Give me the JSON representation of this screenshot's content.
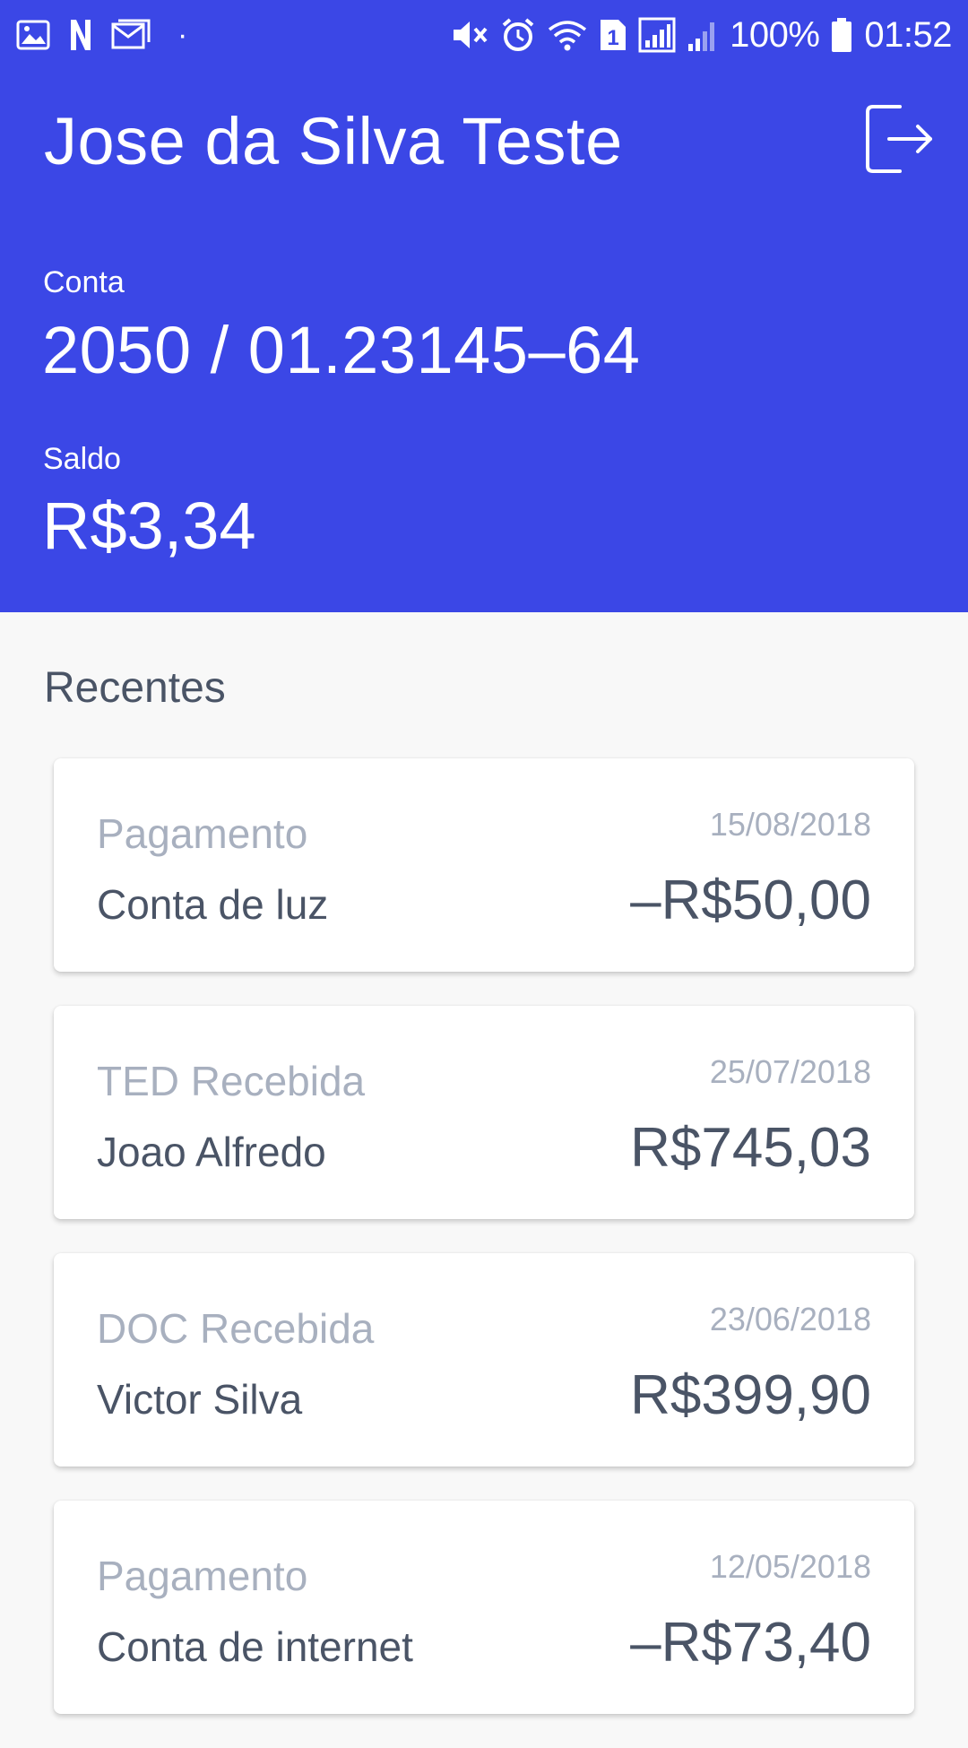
{
  "status_bar": {
    "battery_percent": "100%",
    "time": "01:52",
    "sim_slot": "1",
    "left_icons": [
      "image-icon",
      "n-app-icon",
      "mail-icon"
    ],
    "right_icons": [
      "mute-icon",
      "alarm-icon",
      "wifi-icon",
      "sim-icon",
      "signal-icon",
      "signal-icon",
      "battery-icon"
    ]
  },
  "header": {
    "user_name": "Jose da Silva Teste",
    "logout_icon": "logout-icon",
    "conta_label": "Conta",
    "conta_value": "2050 / 01.23145–64",
    "saldo_label": "Saldo",
    "saldo_value": "R$3,34",
    "background_color": "#3b47e6"
  },
  "recent": {
    "title": "Recentes",
    "items": [
      {
        "type": "Pagamento",
        "description": "Conta de luz",
        "date": "15/08/2018",
        "amount": "–R$50,00"
      },
      {
        "type": "TED Recebida",
        "description": "Joao Alfredo",
        "date": "25/07/2018",
        "amount": "R$745,03"
      },
      {
        "type": "DOC Recebida",
        "description": "Victor Silva",
        "date": "23/06/2018",
        "amount": "R$399,90"
      },
      {
        "type": "Pagamento",
        "description": "Conta de internet",
        "date": "12/05/2018",
        "amount": "–R$73,40"
      }
    ]
  }
}
